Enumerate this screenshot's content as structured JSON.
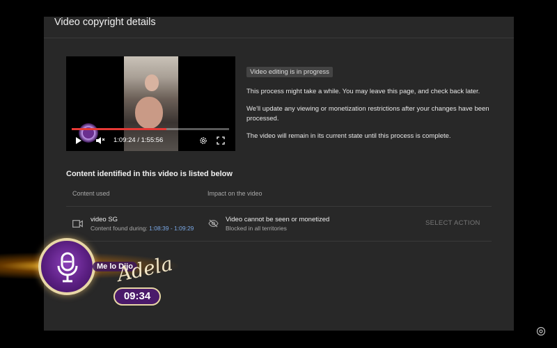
{
  "dialog": {
    "title": "Video copyright details"
  },
  "video": {
    "time": "1:09:24 / 1:55:56",
    "progress": 0.6,
    "colors": {
      "progress": "#e53935"
    }
  },
  "status": {
    "badge": "Video editing is in progress",
    "line1": "This process might take a while. You may leave this page, and check back later.",
    "line2": "We'll update any viewing or monetization restrictions after your changes have been processed.",
    "line3": "The video will remain in its current state until this process is complete."
  },
  "content": {
    "section_title": "Content identified in this video is listed below",
    "columns": [
      "Content used",
      "Impact on the video"
    ],
    "rows": [
      {
        "icon": "camera-icon",
        "name": "video SG",
        "found_label": "Content found during:",
        "found_range": "1:08:39 - 1:09:29",
        "impact_icon": "eye-off-icon",
        "impact_title": "Video cannot be seen or monetized",
        "impact_sub": "Blocked in all territories",
        "action": "SELECT ACTION"
      }
    ]
  },
  "overlay": {
    "brand_line": "Me lo Dijo",
    "brand_script": "Adela",
    "clock": "09:34"
  }
}
